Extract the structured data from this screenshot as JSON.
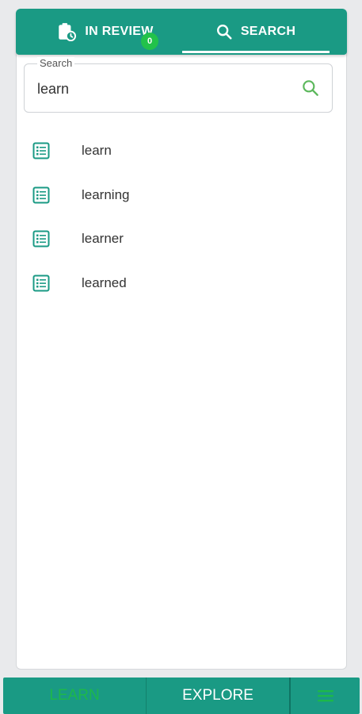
{
  "tabs": {
    "review_label": "IN REVIEW",
    "review_badge": "0",
    "search_label": "SEARCH"
  },
  "search": {
    "label": "Search",
    "value": "learn",
    "placeholder": ""
  },
  "results": [
    {
      "text": "learn"
    },
    {
      "text": "learning"
    },
    {
      "text": "learner"
    },
    {
      "text": "learned"
    }
  ],
  "bottom_nav": {
    "learn_label": "LEARN",
    "explore_label": "EXPLORE"
  },
  "colors": {
    "brand": "#1a9a84",
    "badge": "#22c24a",
    "search_icon": "#5cb85c",
    "learn_active": "#1db84a"
  },
  "icons": {
    "review_tab": "clipboard-clock-icon",
    "search_tab": "search-icon",
    "search_field": "search-icon",
    "result_item": "list-document-icon",
    "menu": "hamburger-menu-icon"
  }
}
